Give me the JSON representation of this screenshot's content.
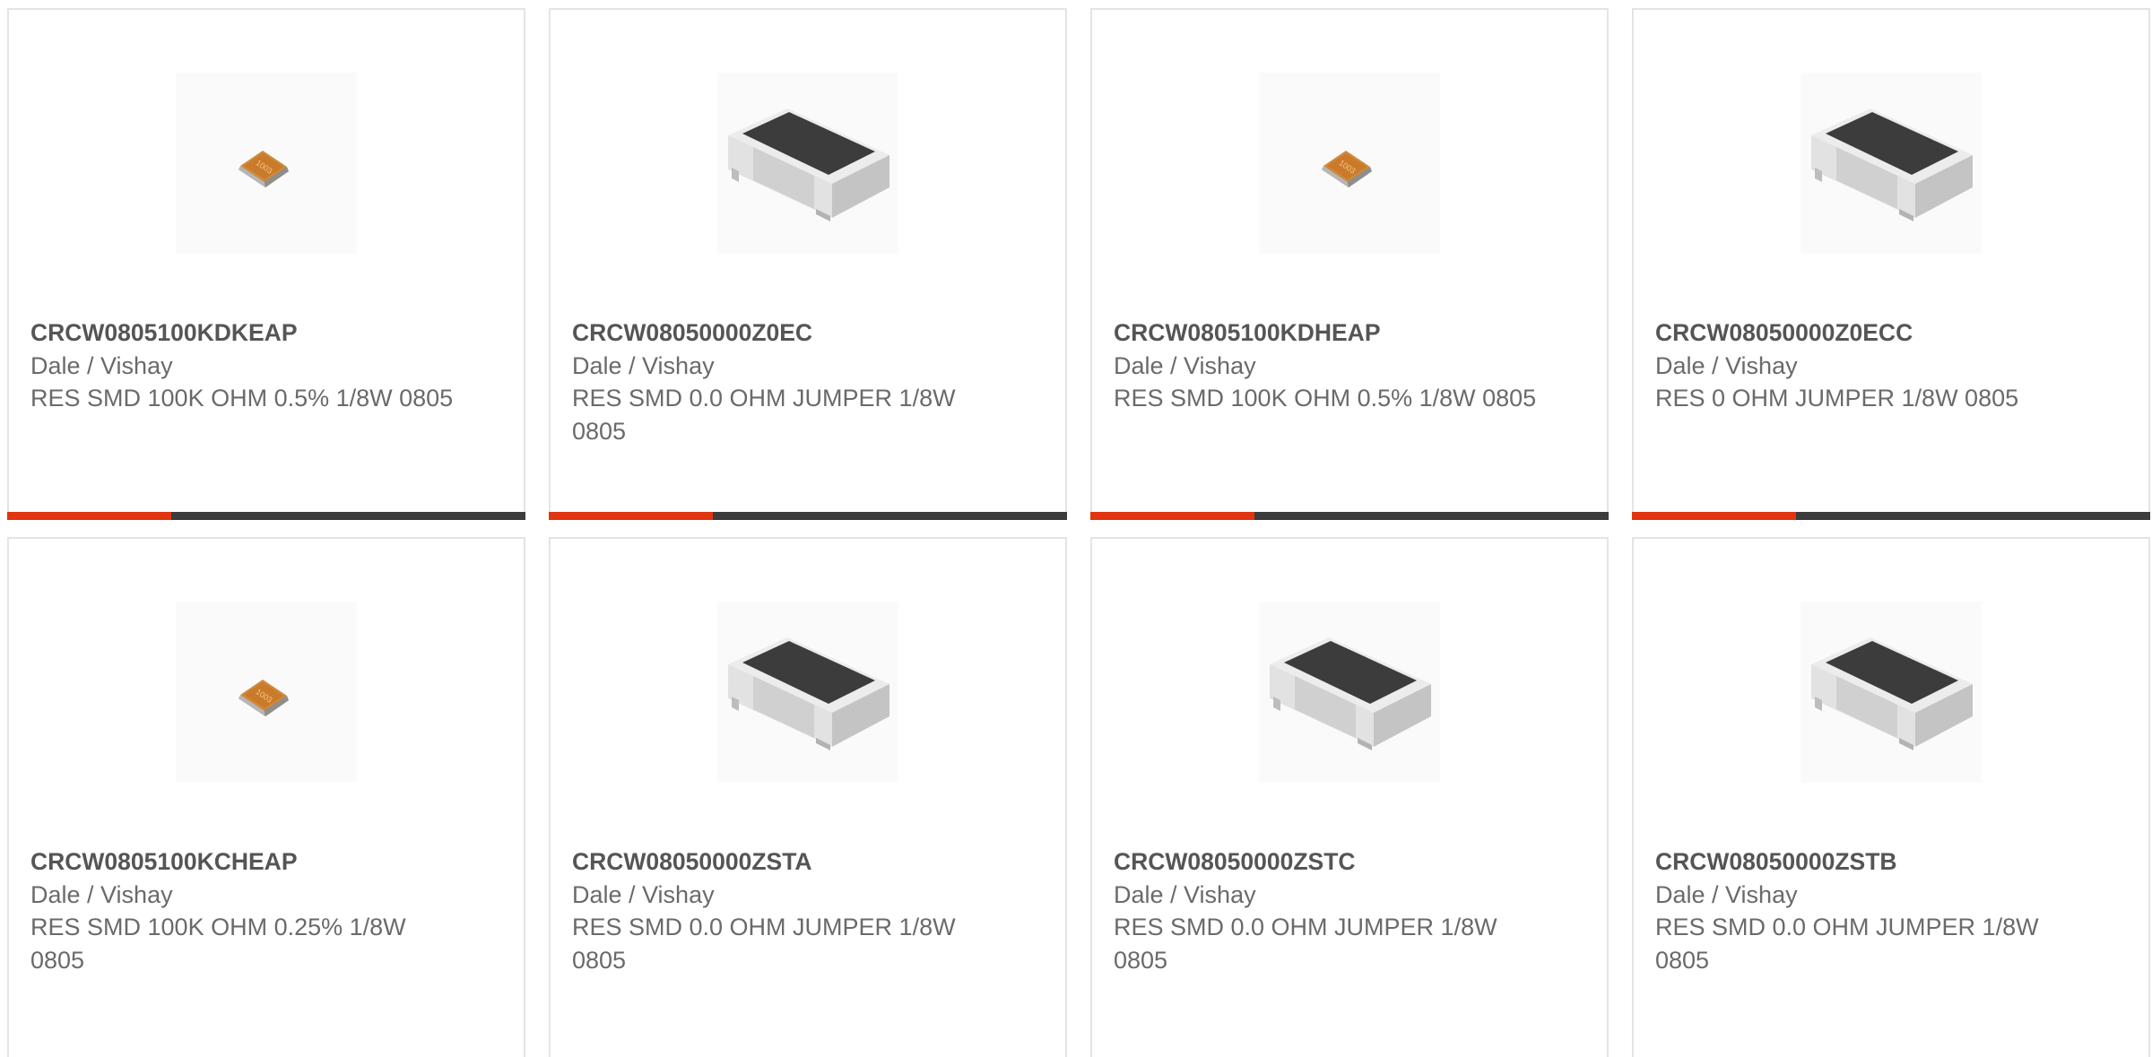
{
  "accent_color": "#e03510",
  "bar_color": "#3c3c3c",
  "products": [
    {
      "part": "CRCW0805100KDKEAP",
      "manufacturer": "Dale / Vishay",
      "description": "RES SMD 100K OHM 0.5% 1/8W 0805",
      "image_icon": "orange-resistor-chip-icon",
      "chip_marking": "1003"
    },
    {
      "part": "CRCW08050000Z0EC",
      "manufacturer": "Dale / Vishay",
      "description": "RES SMD 0.0 OHM JUMPER 1/8W 0805",
      "image_icon": "black-resistor-chip-icon"
    },
    {
      "part": "CRCW0805100KDHEAP",
      "manufacturer": "Dale / Vishay",
      "description": "RES SMD 100K OHM 0.5% 1/8W 0805",
      "image_icon": "orange-resistor-chip-icon",
      "chip_marking": "1003"
    },
    {
      "part": "CRCW08050000Z0ECC",
      "manufacturer": "Dale / Vishay",
      "description": "RES 0 OHM JUMPER 1/8W 0805",
      "image_icon": "black-resistor-chip-icon"
    },
    {
      "part": "CRCW0805100KCHEAP",
      "manufacturer": "Dale / Vishay",
      "description": "RES SMD 100K OHM 0.25% 1/8W 0805",
      "image_icon": "orange-resistor-chip-icon",
      "chip_marking": "1003"
    },
    {
      "part": "CRCW08050000ZSTA",
      "manufacturer": "Dale / Vishay",
      "description": "RES SMD 0.0 OHM JUMPER 1/8W 0805",
      "image_icon": "black-resistor-chip-icon"
    },
    {
      "part": "CRCW08050000ZSTC",
      "manufacturer": "Dale / Vishay",
      "description": "RES SMD 0.0 OHM JUMPER 1/8W 0805",
      "image_icon": "black-resistor-chip-icon"
    },
    {
      "part": "CRCW08050000ZSTB",
      "manufacturer": "Dale / Vishay",
      "description": "RES SMD 0.0 OHM JUMPER 1/8W 0805",
      "image_icon": "black-resistor-chip-icon"
    }
  ]
}
